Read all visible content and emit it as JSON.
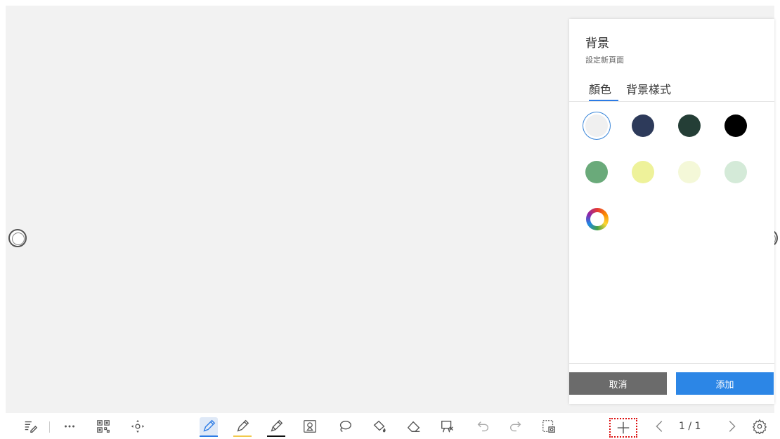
{
  "panel": {
    "title": "背景",
    "subtitle": "設定新頁面",
    "tabs": [
      {
        "label": "顏色",
        "active": true
      },
      {
        "label": "背景樣式",
        "active": false
      }
    ],
    "swatches": [
      {
        "color": "#f0f0f0",
        "selected": true
      },
      {
        "color": "#2d3a5a",
        "selected": false
      },
      {
        "color": "#243e36",
        "selected": false
      },
      {
        "color": "#000000",
        "selected": false
      },
      {
        "color": "#6aaa7a",
        "selected": false
      },
      {
        "color": "#eef29a",
        "selected": false
      },
      {
        "color": "#f4f8d8",
        "selected": false
      },
      {
        "color": "#d4ead8",
        "selected": false
      }
    ],
    "custom_color_icon": "color-wheel-icon",
    "cancel_label": "取消",
    "add_label": "添加",
    "accent_color": "#2c86e6"
  },
  "toolbar": {
    "page_indicator": "1 / 1",
    "pen_colors": [
      "#2c7be5",
      "#f2c94c",
      "#111111"
    ],
    "icons": [
      "note-edit-icon",
      "more-icon",
      "qrcode-icon",
      "move-icon",
      "pen-icon",
      "highlighter-icon",
      "pencil-icon",
      "shape-icon",
      "lasso-icon",
      "fill-bucket-icon",
      "eraser-icon",
      "board-clear-icon",
      "undo-icon",
      "redo-icon",
      "screenshot-icon",
      "add-page-icon",
      "prev-page-icon",
      "next-page-icon",
      "settings-icon"
    ]
  }
}
